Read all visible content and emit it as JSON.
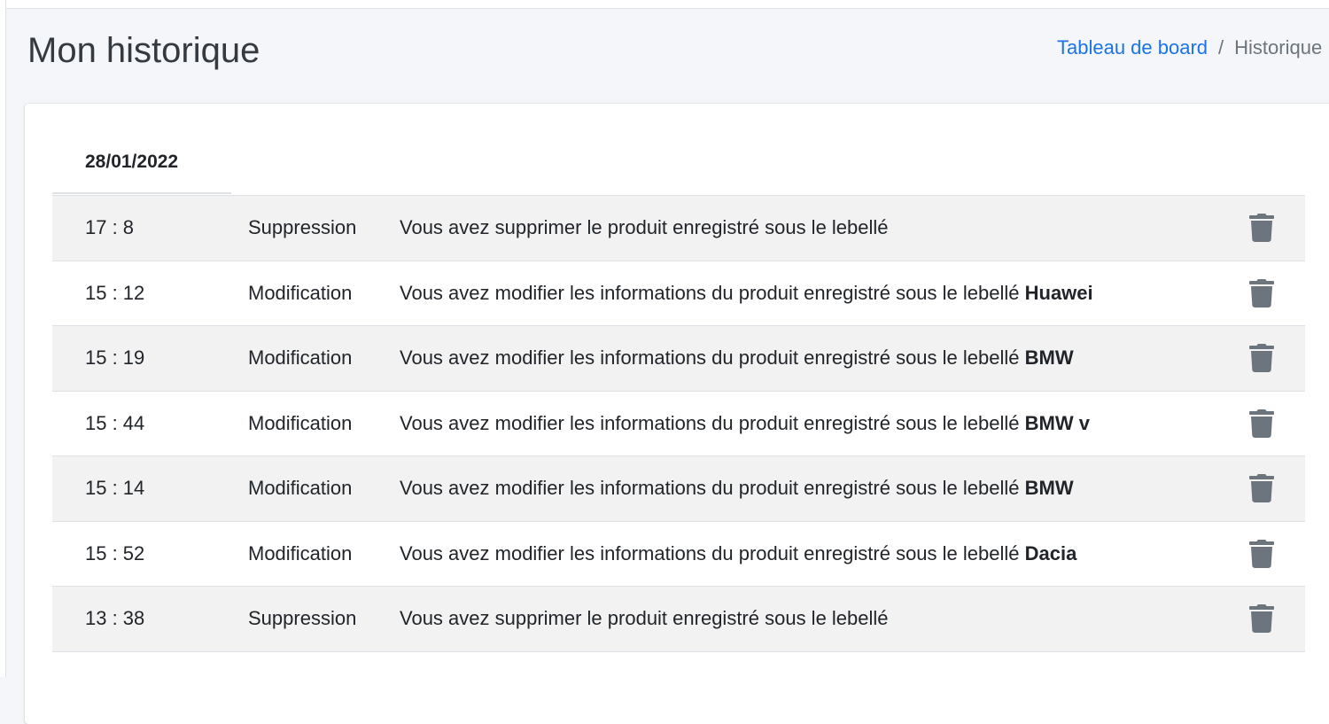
{
  "header": {
    "title": "Mon historique",
    "breadcrumb": {
      "home_label": "Tableau de board",
      "separator": "/",
      "current_label": "Historique"
    }
  },
  "history": {
    "date": "28/01/2022",
    "rows": [
      {
        "time": "17 : 8",
        "action": "Suppression",
        "text": "Vous avez supprimer le produit enregistré sous le lebellé",
        "product": ""
      },
      {
        "time": "15 : 12",
        "action": "Modification",
        "text": "Vous avez modifier les informations du produit enregistré sous le lebellé",
        "product": "Huawei"
      },
      {
        "time": "15 : 19",
        "action": "Modification",
        "text": "Vous avez modifier les informations du produit enregistré sous le lebellé",
        "product": "BMW"
      },
      {
        "time": "15 : 44",
        "action": "Modification",
        "text": "Vous avez modifier les informations du produit enregistré sous le lebellé",
        "product": "BMW v"
      },
      {
        "time": "15 : 14",
        "action": "Modification",
        "text": "Vous avez modifier les informations du produit enregistré sous le lebellé",
        "product": "BMW"
      },
      {
        "time": "15 : 52",
        "action": "Modification",
        "text": "Vous avez modifier les informations du produit enregistré sous le lebellé",
        "product": "Dacia"
      },
      {
        "time": "13 : 38",
        "action": "Suppression",
        "text": "Vous avez supprimer le produit enregistré sous le lebellé",
        "product": ""
      }
    ]
  },
  "icons": {
    "delete": "trash-icon"
  },
  "colors": {
    "link": "#1a73e8",
    "stripe": "#f2f2f2",
    "icon": "#6c757d"
  }
}
